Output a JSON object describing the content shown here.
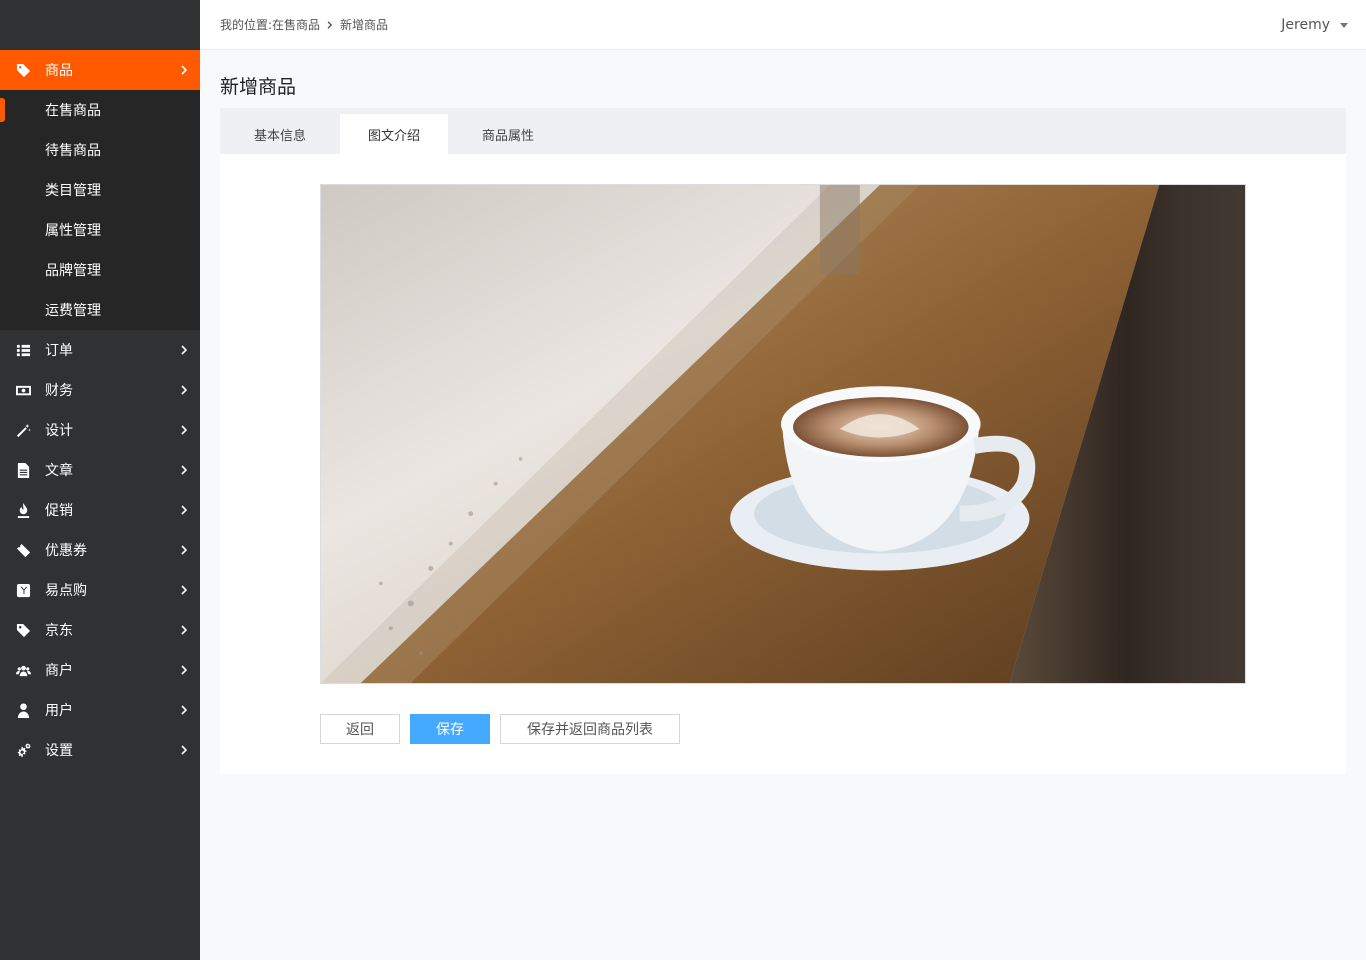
{
  "breadcrumb": {
    "prefix": "我的位置:在售商品",
    "current": "新增商品"
  },
  "user": {
    "name": "Jeremy"
  },
  "sidebar": {
    "active": {
      "label": "商品",
      "icon": "tag-icon"
    },
    "submenu": [
      "在售商品",
      "待售商品",
      "类目管理",
      "属性管理",
      "品牌管理",
      "运费管理"
    ],
    "items": [
      {
        "label": "订单",
        "icon": "list-icon"
      },
      {
        "label": "财务",
        "icon": "money-icon"
      },
      {
        "label": "设计",
        "icon": "magic-wand-icon"
      },
      {
        "label": "文章",
        "icon": "document-icon"
      },
      {
        "label": "促销",
        "icon": "fire-icon"
      },
      {
        "label": "优惠券",
        "icon": "ticket-icon"
      },
      {
        "label": "易点购",
        "icon": "y-badge-icon"
      },
      {
        "label": "京东",
        "icon": "tag-icon"
      },
      {
        "label": "商户",
        "icon": "users-icon"
      },
      {
        "label": "用户",
        "icon": "user-icon"
      },
      {
        "label": "设置",
        "icon": "gears-icon"
      }
    ]
  },
  "page": {
    "title": "新增商品"
  },
  "tabs": [
    "基本信息",
    "图文介绍",
    "商品属性"
  ],
  "buttons": {
    "back": "返回",
    "save": "保存",
    "save_return": "保存并返回商品列表"
  },
  "colors": {
    "accent": "#ff5a00",
    "primary": "#44aaff",
    "sidebar": "#2f3133"
  }
}
